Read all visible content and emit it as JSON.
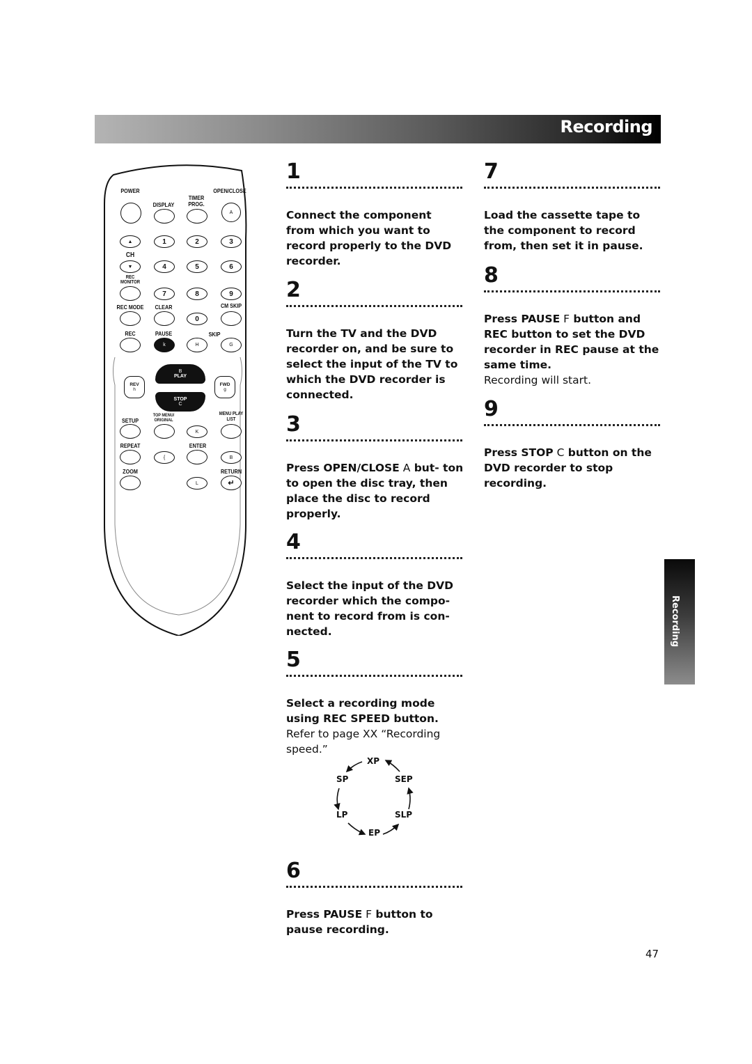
{
  "header": {
    "title": "Recording"
  },
  "side_tab": {
    "label": "Recording"
  },
  "page_number": "47",
  "remote": {
    "labels": {
      "power": "POWER",
      "display": "DISPLAY",
      "timer_prog": "TIMER PROG.",
      "open_close": "OPEN/CLOSE",
      "ch": "CH",
      "rec_monitor": "REC MONITOR",
      "rec_mode": "REC MODE",
      "clear": "CLEAR",
      "cm_skip": "CM SKIP",
      "rec": "REC",
      "pause": "PAUSE",
      "skip": "SKIP",
      "rev": "REV",
      "fwd": "FWD",
      "play": "PLAY",
      "stop": "STOP",
      "setup": "SETUP",
      "top_menu": "TOP MENU/ ORIGINAL",
      "menu": "MENU PLAY LIST",
      "repeat": "REPEAT",
      "enter": "ENTER",
      "zoom": "ZOOM",
      "return": "RETURN"
    },
    "glyphs": {
      "open_close": "A",
      "ch_up": "▲",
      "ch_down": "▼",
      "pause": "k",
      "skip_back": "H",
      "skip_fwd": "G",
      "play": "B",
      "stop": "C",
      "rev": "h",
      "fwd": "g",
      "up": "K",
      "left": "{",
      "right": "B",
      "down": "L",
      "return": "↵"
    },
    "digits": [
      "1",
      "2",
      "3",
      "4",
      "5",
      "6",
      "7",
      "8",
      "9",
      "0"
    ]
  },
  "steps": [
    {
      "number": "1",
      "bold": "Connect the component from which you want to record properly to the DVD recorder.",
      "normal": ""
    },
    {
      "number": "2",
      "bold": "Turn the TV and the DVD recorder on, and be sure to select the input of the TV to which the DVD recorder is connected.",
      "normal": ""
    },
    {
      "number": "3",
      "bold_pre": "Press OPEN/CLOSE",
      "glyph": "A",
      "bold_post": " but- ton to open the disc tray, then place the disc to record properly.",
      "normal": ""
    },
    {
      "number": "4",
      "bold": "Select the input of the DVD recorder which the compo- nent to record from is con- nected.",
      "normal": ""
    },
    {
      "number": "5",
      "bold": "Select a recording mode using REC SPEED button.",
      "normal": "Refer to page XX “Recording speed.”"
    },
    {
      "number": "6",
      "bold_pre": "Press PAUSE",
      "glyph": "F",
      "bold_post": " button to pause recording.",
      "normal": ""
    },
    {
      "number": "7",
      "bold": "Load the cassette tape to the component to record from, then set it in pause.",
      "normal": ""
    },
    {
      "number": "8",
      "bold_pre": "Press PAUSE",
      "glyph": "F",
      "bold_post": " button and REC button to set the DVD recorder in REC pause at the same time.",
      "normal": "Recording will start."
    },
    {
      "number": "9",
      "bold_pre": "Press STOP",
      "glyph": "C",
      "bold_post": " button on the DVD recorder to stop recording.",
      "normal": ""
    }
  ],
  "speed_cycle": {
    "modes": [
      "XP",
      "SEP",
      "SLP",
      "EP",
      "LP",
      "SP"
    ]
  }
}
